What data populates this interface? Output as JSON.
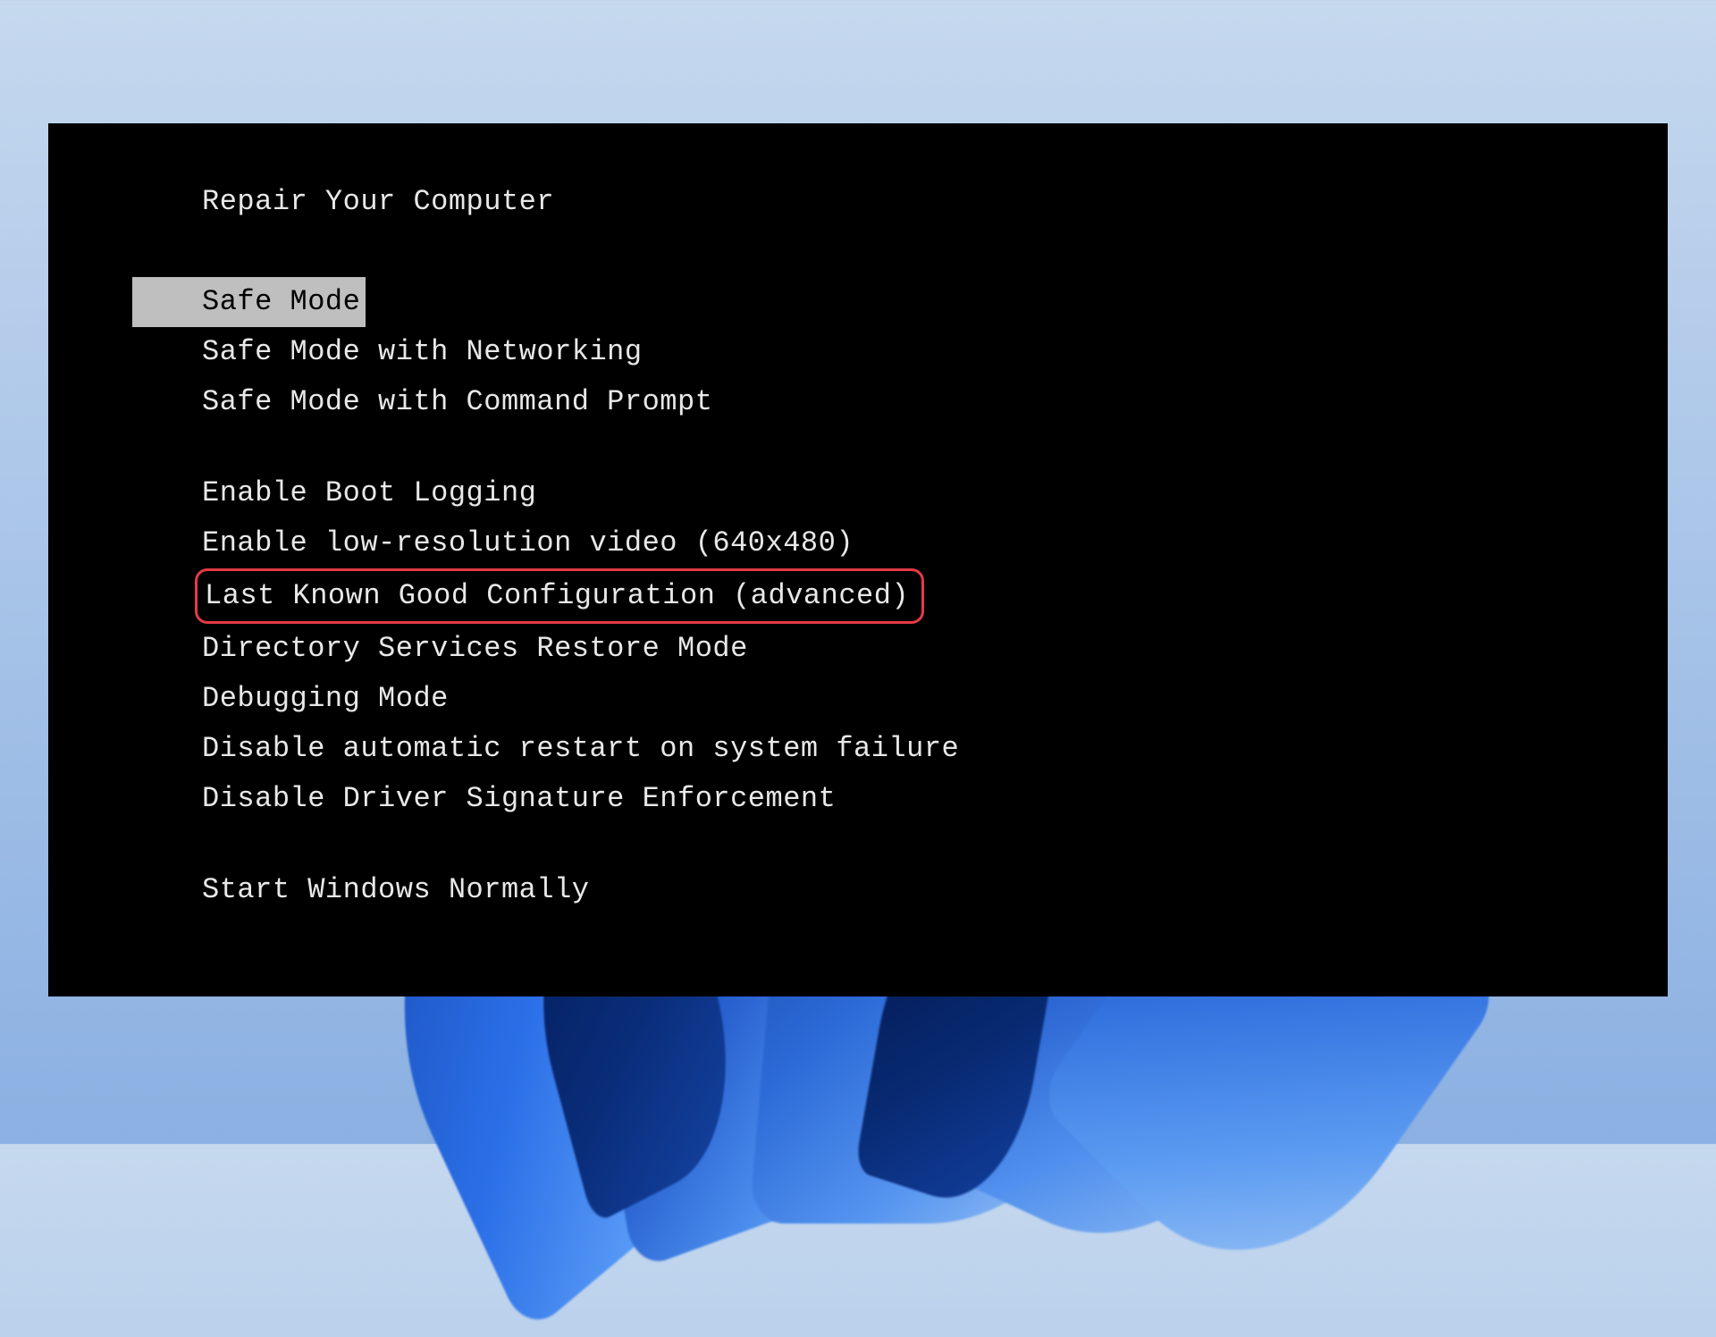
{
  "boot_menu": {
    "header": "Repair Your Computer",
    "group_safe_mode": [
      {
        "label": "Safe Mode",
        "selected": true,
        "highlighted": false
      },
      {
        "label": "Safe Mode with Networking",
        "selected": false,
        "highlighted": false
      },
      {
        "label": "Safe Mode with Command Prompt",
        "selected": false,
        "highlighted": false
      }
    ],
    "group_advanced": [
      {
        "label": "Enable Boot Logging",
        "selected": false,
        "highlighted": false
      },
      {
        "label": "Enable low-resolution video (640x480)",
        "selected": false,
        "highlighted": false
      },
      {
        "label": "Last Known Good Configuration (advanced)",
        "selected": false,
        "highlighted": true
      },
      {
        "label": "Directory Services Restore Mode",
        "selected": false,
        "highlighted": false
      },
      {
        "label": "Debugging Mode",
        "selected": false,
        "highlighted": false
      },
      {
        "label": "Disable automatic restart on system failure",
        "selected": false,
        "highlighted": false
      },
      {
        "label": "Disable Driver Signature Enforcement",
        "selected": false,
        "highlighted": false
      }
    ],
    "group_normal": [
      {
        "label": "Start Windows Normally",
        "selected": false,
        "highlighted": false
      }
    ]
  },
  "annotation": {
    "highlight_color": "#e63946"
  }
}
